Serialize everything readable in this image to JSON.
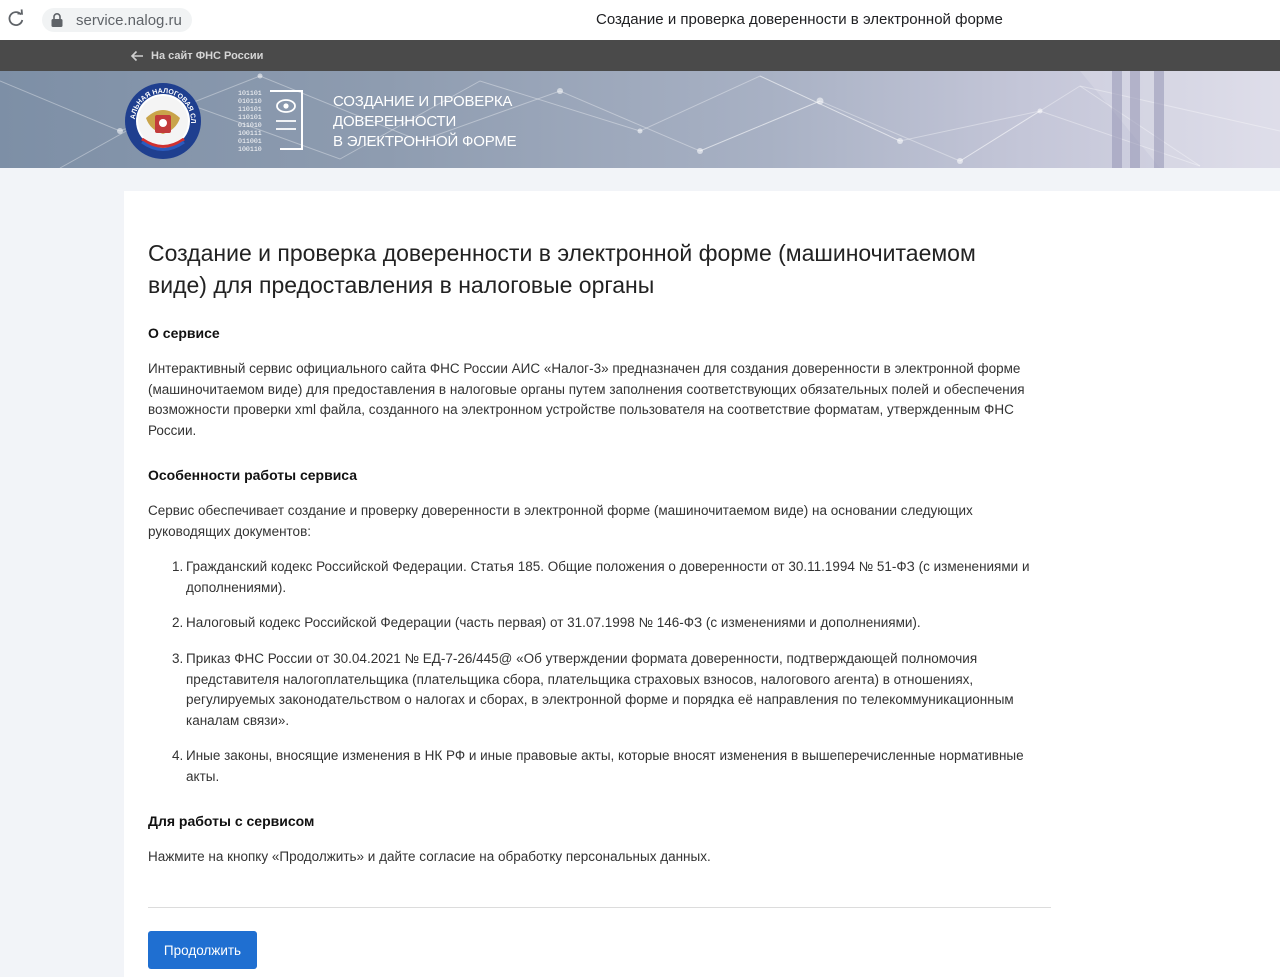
{
  "browser": {
    "url": "service.nalog.ru",
    "tab_title": "Создание и проверка доверенности в электронной форме"
  },
  "nav": {
    "back_link": "На сайт ФНС России"
  },
  "banner": {
    "title_lines": [
      "СОЗДАНИЕ И ПРОВЕРКА",
      "ДОВЕРЕННОСТИ",
      "В ЭЛЕКТРОННОЙ ФОРМЕ"
    ],
    "emblem_text": "ФЕДЕРАЛЬНАЯ НАЛОГОВАЯ СЛУЖБА",
    "code_lines": [
      "101101",
      "010110",
      "110101",
      "110101",
      "011010",
      "100111",
      "011001",
      "100110"
    ]
  },
  "main": {
    "title": "Создание и проверка доверенности в электронной форме (машиночитаемом виде) для предоставления в налоговые органы",
    "about_heading": "О сервисе",
    "about_text": "Интерактивный сервис официального сайта ФНС России АИС «Налог-3» предназначен для создания доверенности в электронной форме (машиночитаемом виде) для предоставления в налоговые органы путем заполнения соответствующих обязательных полей и обеспечения возможности проверки xml файла, созданного на электронном устройстве пользователя на соответствие форматам, утвержденным ФНС России.",
    "features_heading": "Особенности работы сервиса",
    "features_text": "Сервис обеспечивает создание и проверку доверенности в электронной форме (машиночитаемом виде) на основании следующих руководящих документов:",
    "documents": [
      {
        "num": "1.",
        "text": "Гражданский кодекс Российской Федерации. Статья 185. Общие положения о доверенности от 30.11.1994 № 51-ФЗ (с изменениями и дополнениями)."
      },
      {
        "num": "2.",
        "text": "Налоговый кодекс Российской Федерации (часть первая) от 31.07.1998 № 146-ФЗ (с изменениями и дополнениями)."
      },
      {
        "num": "3.",
        "text": "Приказ ФНС России от 30.04.2021 № ЕД-7-26/445@ «Об утверждении формата доверенности, подтверждающей полномочия представителя налогоплательщика (плательщика сбора, плательщика страховых взносов, налогового агента) в отношениях, регулируемых законодательством о налогах и сборах, в электронной форме и порядка её направления по телекоммуникационным каналам связи»."
      },
      {
        "num": "4.",
        "text": "Иные законы, вносящие изменения в НК РФ и иные правовые акты, которые вносят изменения в вышеперечисленные нормативные акты."
      }
    ],
    "usage_heading": "Для работы с сервисом",
    "usage_text": "Нажмите на кнопку «Продолжить» и дайте согласие на обработку персональных данных.",
    "continue_label": "Продолжить"
  },
  "colors": {
    "accent": "#1f6fd1",
    "nav_bg": "#4a4a4a",
    "page_bg": "#f2f4f8"
  }
}
